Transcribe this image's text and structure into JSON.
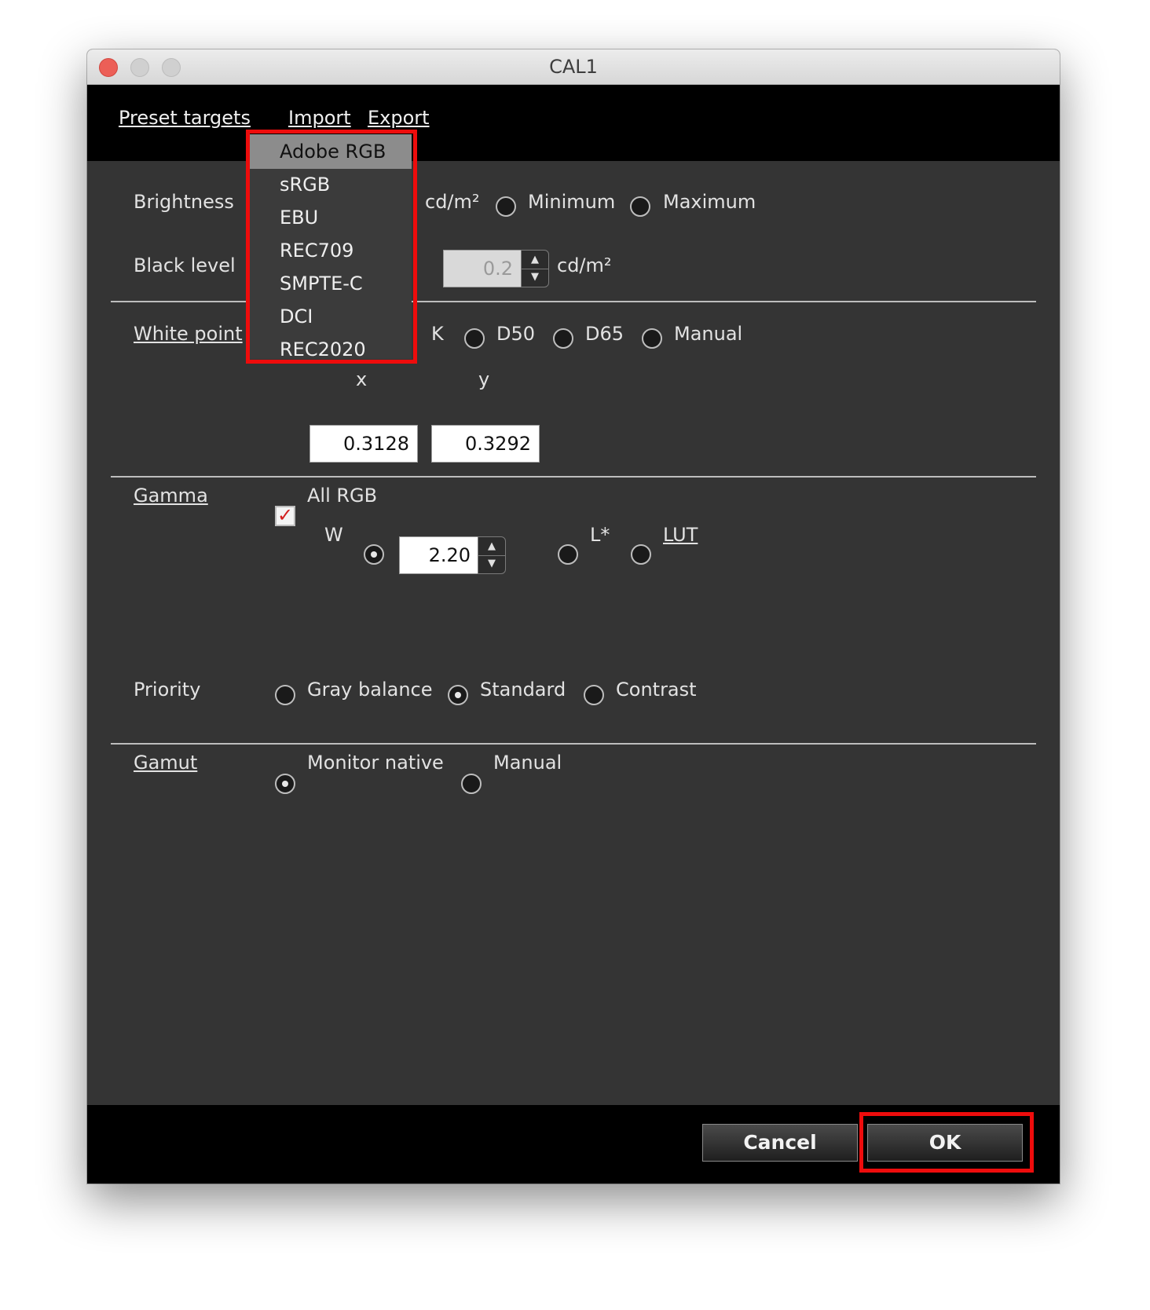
{
  "window": {
    "title": "CAL1"
  },
  "menubar": {
    "preset_targets": "Preset targets",
    "import": "Import",
    "export": "Export"
  },
  "preset_dropdown": {
    "items": [
      "Adobe RGB",
      "sRGB",
      "EBU",
      "REC709",
      "SMPTE-C",
      "DCI",
      "REC2020"
    ],
    "selected": "Adobe RGB"
  },
  "brightness": {
    "label": "Brightness",
    "unit": "cd/m²",
    "option_minimum": "Minimum",
    "option_maximum": "Maximum"
  },
  "black_level": {
    "label": "Black level",
    "value": "0.2",
    "unit": "cd/m²"
  },
  "white_point": {
    "label": "White point",
    "unit_k": "K",
    "option_d50": "D50",
    "option_d65": "D65",
    "option_manual": "Manual",
    "x_label": "x",
    "y_label": "y",
    "x_value": "0.3128",
    "y_value": "0.3292"
  },
  "gamma": {
    "label": "Gamma",
    "all_rgb_label": "All RGB",
    "all_rgb_checked": true,
    "channel_label": "W",
    "value": "2.20",
    "option_lstar": "L*",
    "option_lut": "LUT"
  },
  "priority": {
    "label": "Priority",
    "options": [
      "Gray balance",
      "Standard",
      "Contrast"
    ],
    "selected": "Standard"
  },
  "gamut": {
    "label": "Gamut",
    "options": [
      "Monitor native",
      "Manual"
    ],
    "selected": "Monitor native"
  },
  "footer": {
    "cancel_label": "Cancel",
    "ok_label": "OK"
  },
  "colors": {
    "highlight": "#ee0c0c",
    "panel": "#343434",
    "bar": "#000000",
    "checkmark": "#d21f1f"
  }
}
